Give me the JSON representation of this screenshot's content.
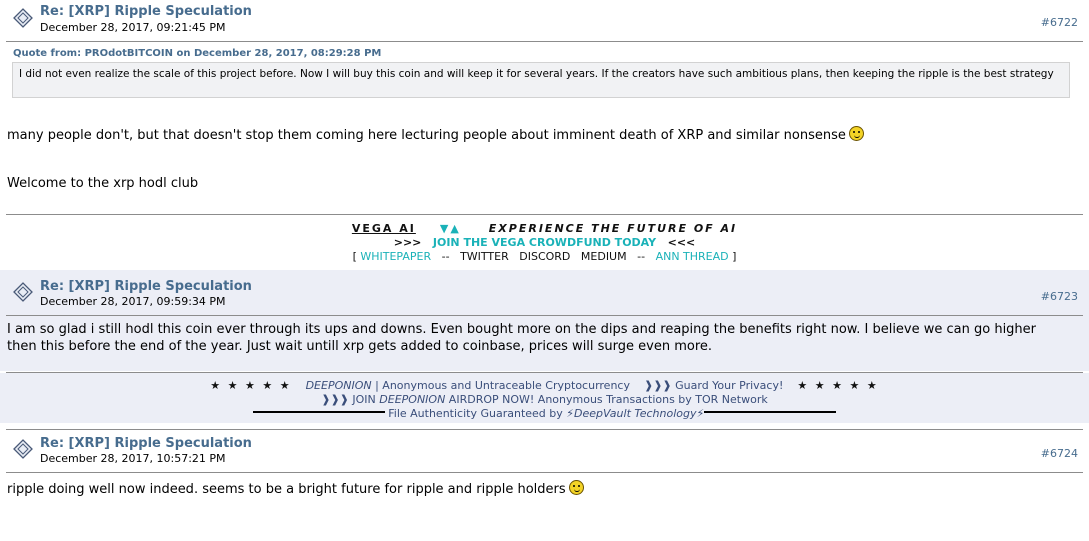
{
  "posts": [
    {
      "title": "Re: [XRP] Ripple Speculation",
      "date": "December 28, 2017, 09:21:45 PM",
      "number": "#6722",
      "quote_header": "Quote from: PROdotBITCOIN on December 28, 2017, 08:29:28 PM",
      "quote_text": "I did not even realize the scale of this project before. Now I will buy this coin and will keep it for several years. If the creators have such ambitious plans, then keeping the ripple is the best strategy",
      "body_line1": "many people don't, but that doesn't stop them coming here lecturing people about imminent death of XRP and similar nonsense",
      "body_line2": "Welcome to the xrp hodl club"
    },
    {
      "title": "Re: [XRP] Ripple Speculation",
      "date": "December 28, 2017, 09:59:34 PM",
      "number": "#6723",
      "body_line1": "I am so glad i still hodl this coin ever through its ups and downs. Even bought more on the dips and reaping the benefits right now. I believe we can go higher",
      "body_line2": "then this before the end of the year. Just wait untill xrp gets added to coinbase, prices will surge even more."
    },
    {
      "title": "Re: [XRP] Ripple Speculation",
      "date": "December 28, 2017, 10:57:21 PM",
      "number": "#6724",
      "body_line1": "ripple doing well now indeed. seems to be a bright future for ripple and ripple holders"
    }
  ],
  "ad_vega": {
    "brand": "VEGA AI",
    "arrows": "▼▲",
    "tagline": "EXPERIENCE THE FUTURE OF AI",
    "cta_left": ">>>",
    "cta": "JOIN THE VEGA CROWDFUND TODAY",
    "cta_right": "<<<",
    "bracket_open": "[",
    "whitepaper": "WHITEPAPER",
    "sep": "--",
    "twitter": "TWITTER",
    "discord": "DISCORD",
    "medium": "MEDIUM",
    "ann": "ANN THREAD",
    "bracket_close": "]"
  },
  "ad_deep": {
    "stars": "★ ★ ★ ★ ★",
    "brand": "DEEPONION",
    "line1_rest": " | Anonymous and Untraceable Cryptocurrency",
    "privacy": "❱❱❱  Guard Your Privacy!",
    "line2_a": "❱❱❱ JOIN ",
    "line2_b": "DEEPONION",
    "line2_c": " AIRDROP NOW!  Anonymous Transactions by TOR Network",
    "line3": "File Authenticity Guaranteed by ",
    "line3_italic": "⚡DeepVault Technology⚡"
  },
  "icon_names": [
    "message-icon"
  ],
  "colors": {
    "link": "#476c8e",
    "accent": "#1ab2b8",
    "alt_bg": "#eceef6"
  }
}
